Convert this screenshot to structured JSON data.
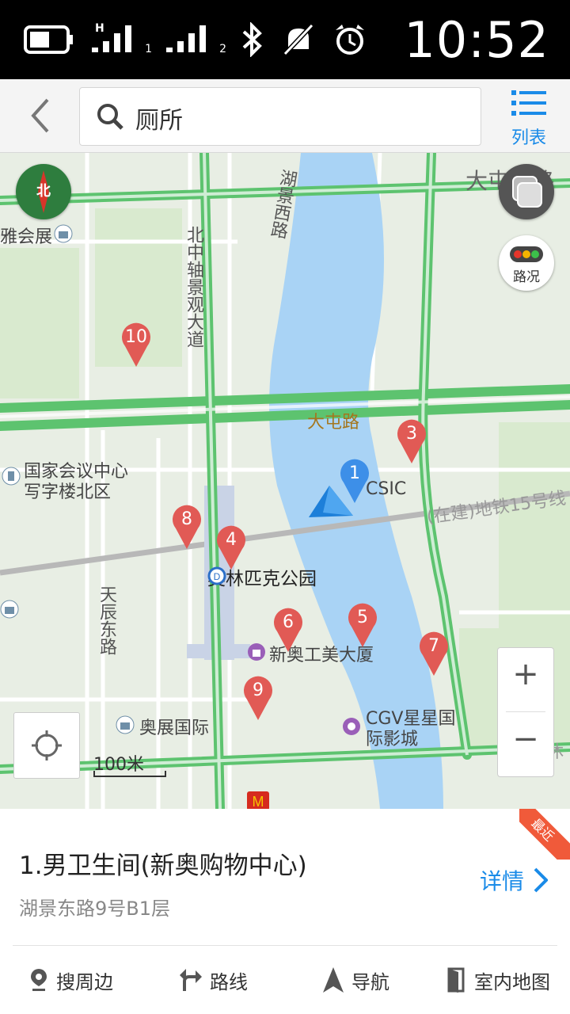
{
  "status_bar": {
    "time": "10:52",
    "signal1_label": "1",
    "signal2_label": "2",
    "network_label": "H",
    "icons": [
      "battery-icon",
      "signal-icon",
      "signal-icon",
      "bluetooth-icon",
      "mute-icon",
      "alarm-icon"
    ]
  },
  "search": {
    "query": "厕所",
    "list_label": "列表"
  },
  "map": {
    "compass_label": "北",
    "traffic_label": "路况",
    "zoom_in": "+",
    "zoom_out": "−",
    "scale_label": "100米",
    "labels": {
      "exhibition": "雅会展",
      "road_north_axis": "北中轴景观大道",
      "road_hujing": "湖景西路",
      "road_datun_north": "大屯北路",
      "road_datun": "大屯路",
      "national_center": "国家会议中心",
      "national_center_2": "写字楼北区",
      "csic": "CSIC",
      "subway15": "(在建)地铁15号线",
      "olympic_park": "奥林匹克公园",
      "tianchen": "天辰东路",
      "xinao_tower": "新奥工美大厦",
      "aozhan": "奥展国际",
      "cgv": "CGV星星国",
      "cgv2": "际影城",
      "right_edge": "家休"
    },
    "pins": [
      "1",
      "3",
      "4",
      "5",
      "6",
      "7",
      "8",
      "9",
      "10"
    ],
    "colors": {
      "water": "#a9d3f5",
      "road_green": "#5dc36f",
      "pin_red": "#e15a55",
      "pin_blue": "#3d8fe8"
    }
  },
  "result": {
    "title": "1.男卫生间(新奥购物中心)",
    "address": "湖景东路9号B1层",
    "detail_label": "详情",
    "badge": "最近",
    "actions": [
      {
        "label": "搜周边",
        "icon": "pin-icon"
      },
      {
        "label": "路线",
        "icon": "route-icon"
      },
      {
        "label": "导航",
        "icon": "navigation-icon"
      },
      {
        "label": "室内地图",
        "icon": "indoor-map-icon"
      }
    ]
  }
}
